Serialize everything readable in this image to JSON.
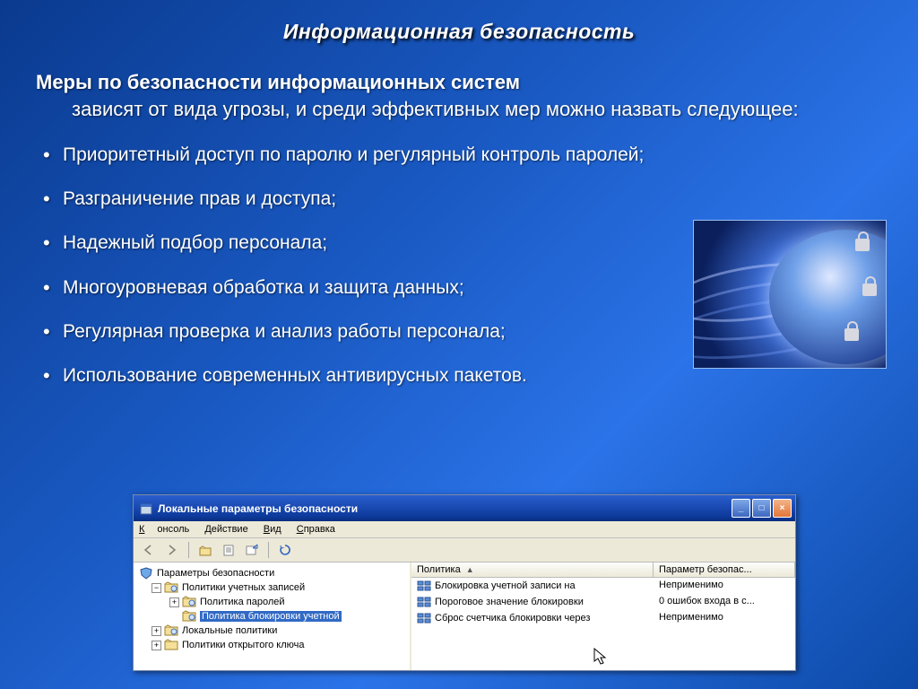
{
  "slide": {
    "title": "Информационная безопасность",
    "heading_bold": "Меры по безопасности информационных систем",
    "heading_cont": "зависят от вида угрозы, и среди эффективных мер можно назвать следующее:"
  },
  "bullets": [
    "Приоритетный доступ по паролю и регулярный контроль паролей;",
    "Разграничение прав и доступа;",
    "Надежный подбор персонала;",
    "Многоуровневая обработка и защита данных;",
    "Регулярная проверка и анализ работы персонала;",
    "Использование современных антивирусных пакетов."
  ],
  "dialog": {
    "title": "Локальные параметры безопасности",
    "menu": {
      "console": "Консоль",
      "action": "Действие",
      "view": "Вид",
      "help": "Справка"
    },
    "tree": [
      {
        "label": "Параметры безопасности",
        "level": 0,
        "expander": "none",
        "icon": "shield"
      },
      {
        "label": "Политики учетных записей",
        "level": 1,
        "expander": "minus",
        "icon": "folder"
      },
      {
        "label": "Политика паролей",
        "level": 2,
        "expander": "plus",
        "icon": "folder"
      },
      {
        "label": "Политика блокировки учетной",
        "level": 2,
        "expander": "none",
        "icon": "folder",
        "selected": true
      },
      {
        "label": "Локальные политики",
        "level": 1,
        "expander": "plus",
        "icon": "folder"
      },
      {
        "label": "Политики открытого ключа",
        "level": 1,
        "expander": "plus",
        "icon": "folder"
      }
    ],
    "columns": {
      "a": "Политика",
      "b": "Параметр безопас..."
    },
    "rows": [
      {
        "a": "Блокировка учетной записи на",
        "b": "Неприменимо"
      },
      {
        "a": "Пороговое значение блокировки",
        "b": "0 ошибок входа в с..."
      },
      {
        "a": "Сброс счетчика блокировки через",
        "b": "Неприменимо"
      }
    ]
  }
}
